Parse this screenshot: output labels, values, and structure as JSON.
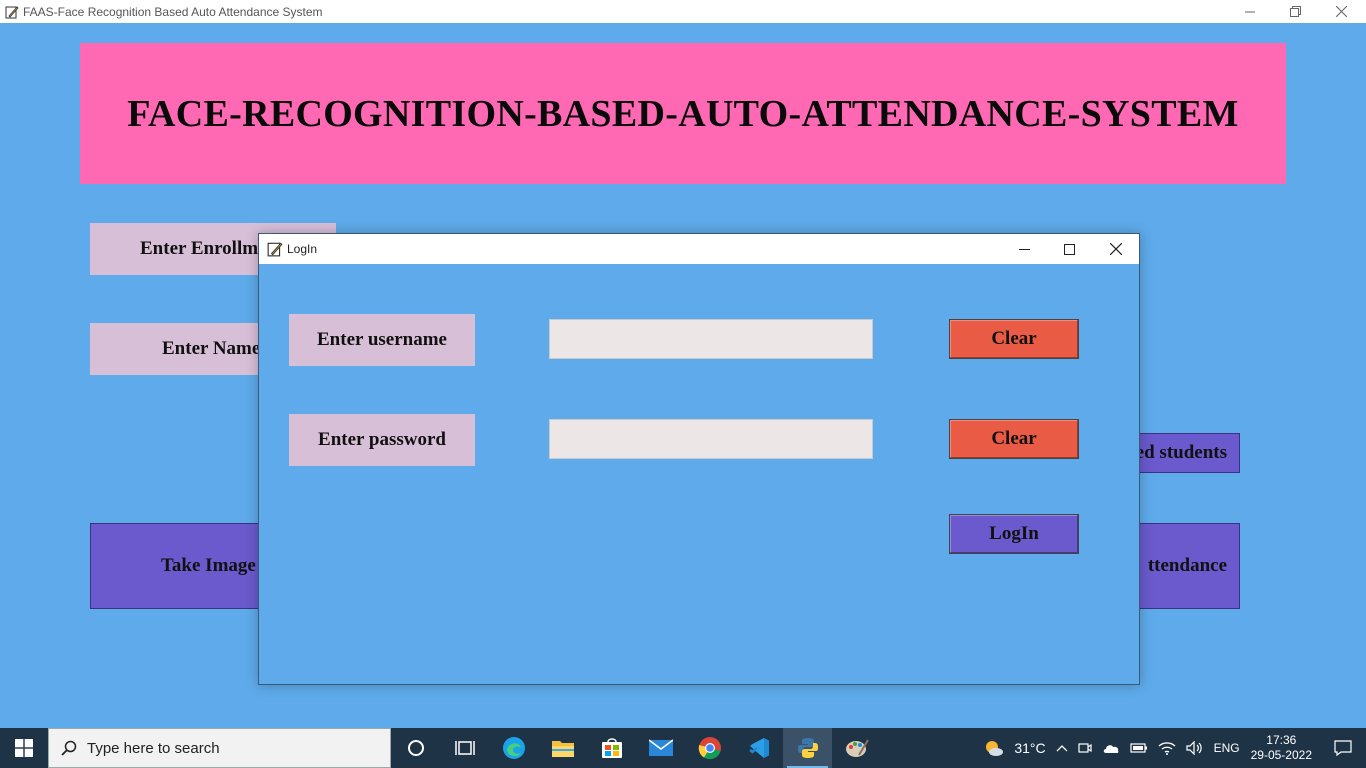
{
  "main_window": {
    "title": "FAAS-Face Recognition Based Auto Attendance System"
  },
  "banner": {
    "title": "FACE-RECOGNITION-BASED-AUTO-ATTENDANCE-SYSTEM"
  },
  "background": {
    "enrollment_label": "Enter Enrollm",
    "name_label": "Enter Name",
    "registered_students_button": "ed students",
    "take_images_button": "Take Image",
    "attendance_button": "ttendance"
  },
  "login_dialog": {
    "title": "LogIn",
    "username_label": "Enter username",
    "password_label": "Enter password",
    "username_value": "",
    "password_value": "",
    "clear_username_label": "Clear",
    "clear_password_label": "Clear",
    "login_button_label": "LogIn"
  },
  "taskbar": {
    "search_placeholder": "Type here to search",
    "weather_temp": "31°C",
    "language": "ENG",
    "time": "17:36",
    "date": "29-05-2022"
  },
  "colors": {
    "background": "#5eaaea",
    "banner": "#ff69b4",
    "label": "#d8bfd8",
    "clear_button": "#e95b45",
    "action_button": "#6a5acd"
  }
}
